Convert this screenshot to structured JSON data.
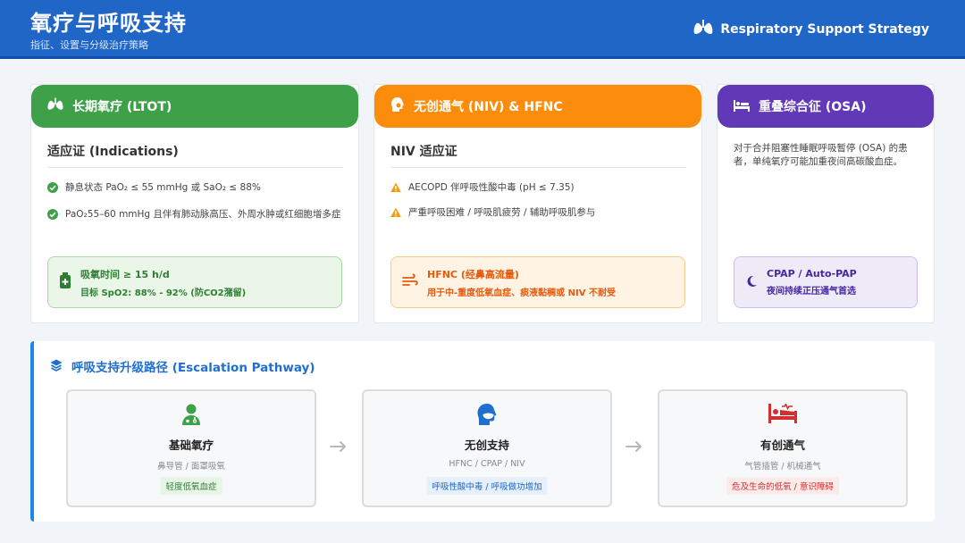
{
  "header": {
    "title": "氧疗与呼吸支持",
    "subtitle": "指征、设置与分级治疗策略",
    "brand": "Respiratory Support Strategy"
  },
  "ltot": {
    "title": "长期氧疗 (LTOT)",
    "section": "适应证 (Indications)",
    "items": [
      "静息状态 PaO₂ ≤ 55 mmHg 或 SaO₂ ≤ 88%",
      "PaO₂55–60 mmHg 且伴有肺动脉高压、外周水肿或红细胞增多症"
    ],
    "callout": {
      "line1": "吸氧时间 ≥ 15 h/d",
      "line2": "目标 SpO2: 88% - 92% (防CO2潴留)"
    }
  },
  "niv": {
    "title": "无创通气 (NIV) & HFNC",
    "section": "NIV 适应证",
    "items": [
      "AECOPD 伴呼吸性酸中毒 (pH ≤ 7.35)",
      "严重呼吸困难 / 呼吸肌疲劳 / 辅助呼吸肌参与"
    ],
    "callout": {
      "line1": "HFNC (经鼻高流量)",
      "line2": "用于中-重度低氧血症、痰液黏稠或 NIV 不耐受"
    }
  },
  "osa": {
    "title": "重叠综合征 (OSA)",
    "desc": "对于合并阻塞性睡眠呼吸暂停 (OSA) 的患者，单纯氧疗可能加重夜间高碳酸血症。",
    "callout": {
      "line1": "CPAP / Auto-PAP",
      "line2": "夜间持续正压通气首选"
    }
  },
  "pathway": {
    "title": "呼吸支持升级路径 (Escalation Pathway)",
    "steps": [
      {
        "name": "基础氧疗",
        "desc": "鼻导管 / 面罩吸氧",
        "tag": "轻度低氧血症"
      },
      {
        "name": "无创支持",
        "desc": "HFNC / CPAP / NIV",
        "tag": "呼吸性酸中毒 / 呼吸做功增加"
      },
      {
        "name": "有创通气",
        "desc": "气管插管 / 机械通气",
        "tag": "危及生命的低氧 / 意识障碍"
      }
    ]
  },
  "colors": {
    "header": "#1f66c6",
    "green": "#3fa04a",
    "orange": "#fb8c0c",
    "purple": "#6139b6",
    "blue_accent": "#1e88e5",
    "red": "#d32f2f"
  },
  "icons": {
    "brand": "lungs-icon",
    "ltot": "lungs-icon",
    "niv": "head-mask-icon",
    "osa": "bed-icon",
    "ltot_items": "check-circle-icon",
    "niv_items": "warning-icon",
    "ltot_callout": "oxygen-tank-icon",
    "niv_callout": "wind-icon",
    "osa_callout": "moon-icon",
    "pathway": "layers-icon",
    "step1": "doctor-icon",
    "step2": "head-mask-icon",
    "step3": "hospital-bed-icon",
    "arrows": "arrow-right-icon"
  }
}
